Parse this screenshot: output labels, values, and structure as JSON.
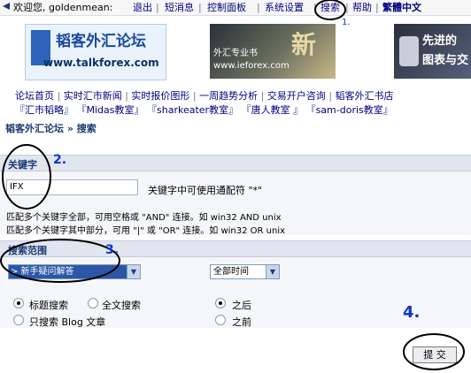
{
  "topbar": {
    "welcome": "欢迎您, goldenmean:",
    "logout": "退出",
    "messages": "短消息",
    "control_panel": "控制面板",
    "system_settings": "系统设置",
    "search": "搜索",
    "help": "帮助",
    "traditional": "繁體中文"
  },
  "banners": {
    "b1_title": "韬客外汇论坛",
    "b1_url": "www.talkforex.com",
    "b2_title": "外汇专业书",
    "b2_url": "www.ieforex.com",
    "b2_char": "新",
    "b3_line1": "先进的",
    "b3_line2": "图表与交"
  },
  "nav": {
    "row1": [
      "论坛首页",
      "实时汇市新闻",
      "实时报价图形",
      "一周趋势分析",
      "交易开户咨询",
      "韬客外汇书店"
    ],
    "row2": [
      "『汇市韬略』",
      "『Midas教室』",
      "『sharkeater教室』",
      "『唐人教室 』",
      "『sam-doris教室』"
    ]
  },
  "breadcrumb": "韬客外汇论坛 » 搜索",
  "keyword_section": {
    "title": "关键字",
    "value": "IFX",
    "hint": "关键字中可使用通配符 \"*\"",
    "help1": "匹配多个关键字全部，可用空格或 \"AND\" 连接。如  win32 AND unix",
    "help2": "匹配多个关键字其中部分，可用 \"|\" 或 \"OR\" 连接。如  win32 OR unix"
  },
  "range_section": {
    "title": "搜索范围",
    "forum_select": "> 新手疑问解答",
    "time_select": "全部时间",
    "radio_title": "标题搜索",
    "radio_fulltext": "全文搜索",
    "radio_only": "只搜索  Blog 文章",
    "radio_after": "之后",
    "radio_before": "之前"
  },
  "submit_label": "提  交",
  "annotations": {
    "n1": "1.",
    "n2": "2.",
    "n3": "3.",
    "n4": "4."
  }
}
